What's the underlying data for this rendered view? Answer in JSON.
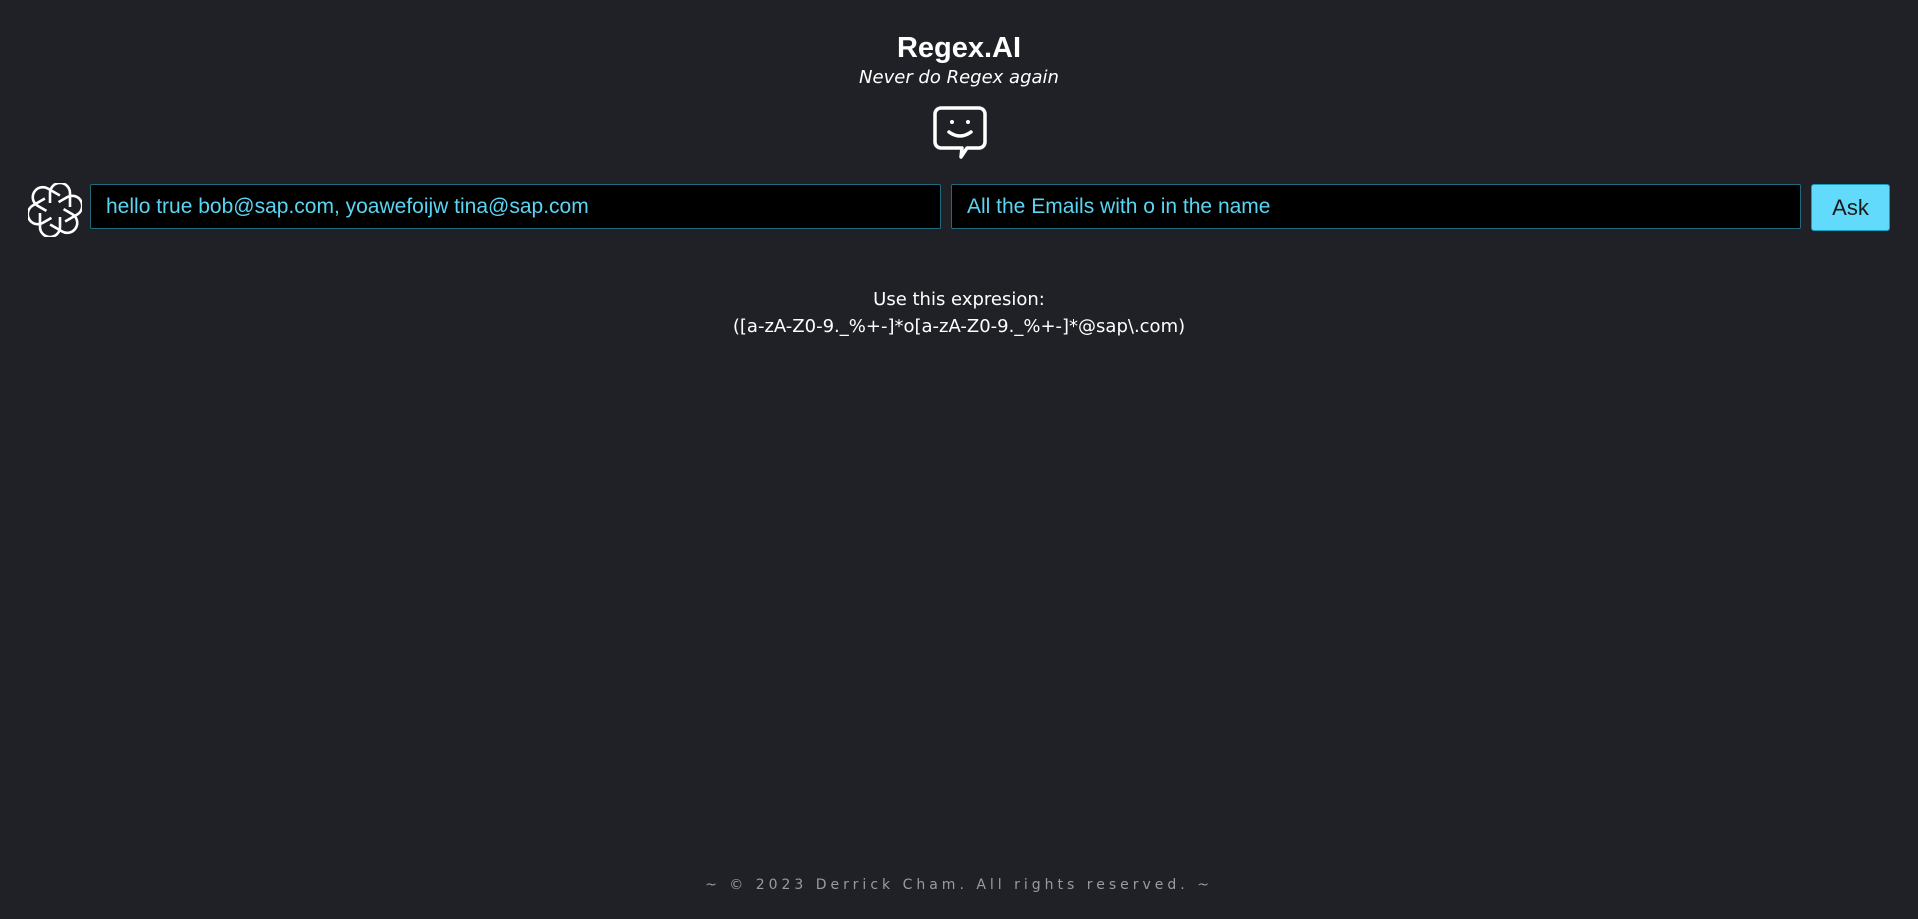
{
  "app": {
    "title": "Regex.AI",
    "subtitle": "Never do Regex again"
  },
  "icons": {
    "header": "smiley-chat-bubble-icon",
    "logo": "openai-logo-icon"
  },
  "form": {
    "text_input": {
      "value": "hello true bob@sap.com, yoawefoijw tina@sap.com"
    },
    "query_input": {
      "value": "All the Emails with o in the name"
    },
    "ask_label": "Ask"
  },
  "result": {
    "label": "Use this expresion:",
    "expression": "([a-zA-Z0-9._%+-]*o[a-zA-Z0-9._%+-]*@sap\\.com)"
  },
  "footer": {
    "text": "~ © 2023 Derrick Cham. All rights reserved. ~"
  },
  "colors": {
    "background": "#202127",
    "accent": "#61dafb",
    "input_text": "#5ad4f2",
    "input_border": "#1f6b7d"
  }
}
